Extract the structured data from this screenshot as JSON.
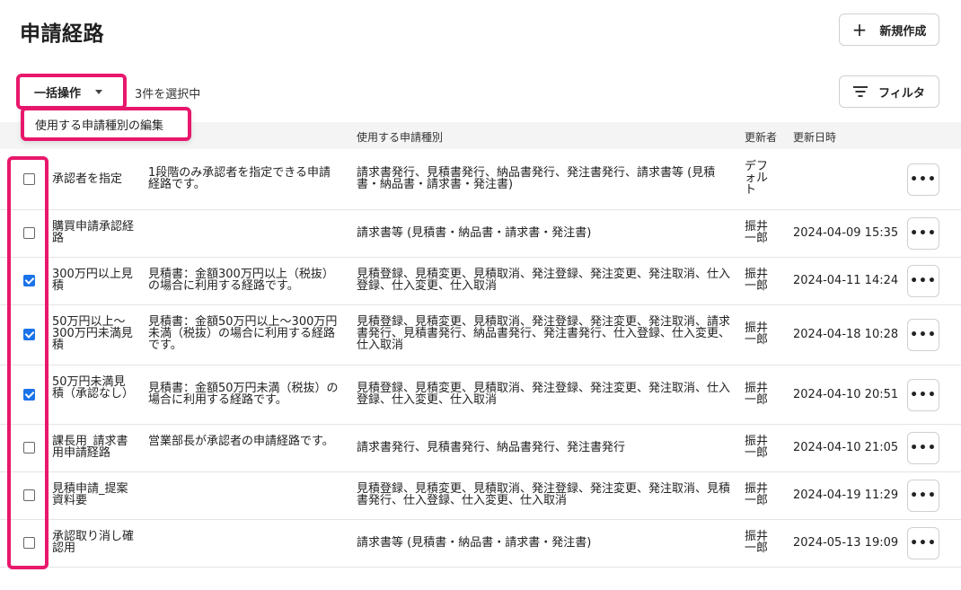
{
  "header": {
    "title": "申請経路",
    "new_button": "新規作成",
    "new_icon": "plus-icon",
    "filter_button": "フィルタ",
    "filter_icon": "filter-icon"
  },
  "toolbar": {
    "bulk_label": "一括操作",
    "selected_count": "3件を選択中",
    "dropdown_item": "使用する申請種別の編集"
  },
  "table": {
    "headers": {
      "types": "使用する申請種別",
      "updater": "更新者",
      "updated_at": "更新日時"
    },
    "rows": [
      {
        "checked": false,
        "name": "承認者を指定",
        "desc": "1段階のみ承認者を指定できる申請経路です。",
        "types": "請求書発行、見積書発行、納品書発行、発注書発行、請求書等 (見積書・納品書・請求書・発注書)",
        "updater": "デフォルト",
        "date": ""
      },
      {
        "checked": false,
        "name": "購買申請承認経路",
        "desc": "",
        "types": "請求書等 (見積書・納品書・請求書・発注書)",
        "updater": "振井一郎",
        "date": "2024-04-09 15:35"
      },
      {
        "checked": true,
        "name": "300万円以上見積",
        "desc": "見積書：金額300万円以上（税抜）の場合に利用する経路です。",
        "types": "見積登録、見積変更、見積取消、発注登録、発注変更、発注取消、仕入登録、仕入変更、仕入取消",
        "updater": "振井一郎",
        "date": "2024-04-11 14:24"
      },
      {
        "checked": true,
        "name": "50万円以上～300万円未満見積",
        "desc": "見積書：金額50万円以上～300万円未満（税抜）の場合に利用する経路です。",
        "types": "見積登録、見積変更、見積取消、発注登録、発注変更、発注取消、請求書発行、見積書発行、納品書発行、発注書発行、仕入登録、仕入変更、仕入取消",
        "updater": "振井一郎",
        "date": "2024-04-18 10:28"
      },
      {
        "checked": true,
        "name": "50万円未満見積（承認なし）",
        "desc": "見積書：金額50万円未満（税抜）の場合に利用する経路です。",
        "types": "見積登録、見積変更、見積取消、発注登録、発注変更、発注取消、仕入登録、仕入変更、仕入取消",
        "updater": "振井一郎",
        "date": "2024-04-10 20:51"
      },
      {
        "checked": false,
        "name": "課長用_請求書用申請経路",
        "desc": "営業部長が承認者の申請経路です。",
        "types": "請求書発行、見積書発行、納品書発行、発注書発行",
        "updater": "振井一郎",
        "date": "2024-04-10 21:05"
      },
      {
        "checked": false,
        "name": "見積申請_提案資料要",
        "desc": "",
        "types": "見積登録、見積変更、見積取消、発注登録、発注変更、発注取消、見積書発行、仕入登録、仕入変更、仕入取消",
        "updater": "振井一郎",
        "date": "2024-04-19 11:29"
      },
      {
        "checked": false,
        "name": "承認取り消し確認用",
        "desc": "",
        "types": "請求書等 (見積書・納品書・請求書・発注書)",
        "updater": "振井一郎",
        "date": "2024-05-13 19:09"
      }
    ],
    "more_icon": "more-horizontal-icon"
  },
  "colors": {
    "highlight": "#e8176b",
    "checkbox_checked": "#1a73e8"
  }
}
